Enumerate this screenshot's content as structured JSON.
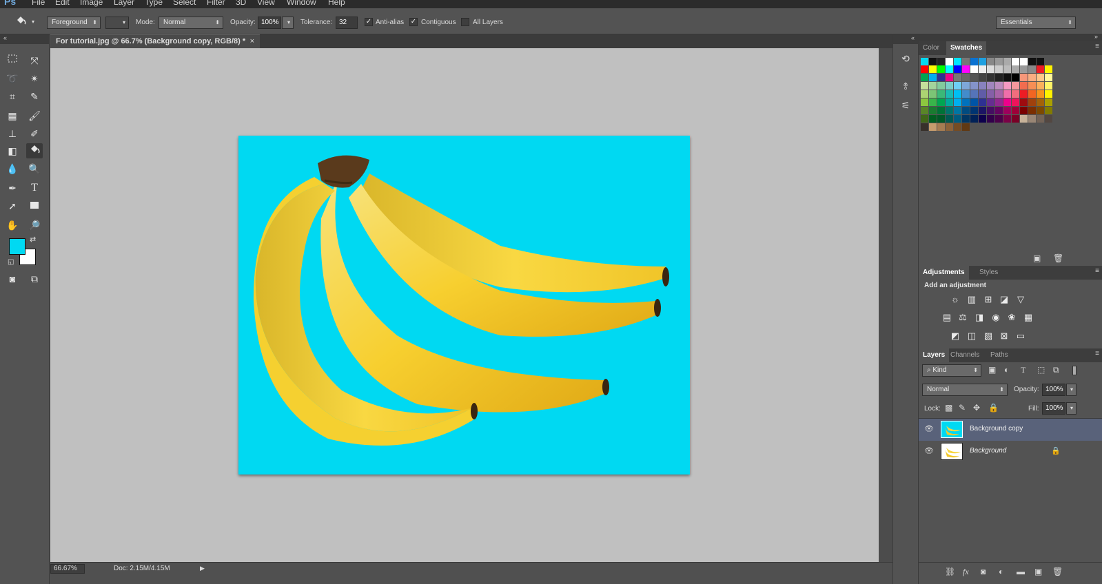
{
  "app": {
    "logo": "Ps"
  },
  "menu": [
    "File",
    "Edit",
    "Image",
    "Layer",
    "Type",
    "Select",
    "Filter",
    "3D",
    "View",
    "Window",
    "Help"
  ],
  "options": {
    "fill_source": "Foreground",
    "mode_label": "Mode:",
    "mode_value": "Normal",
    "opacity_label": "Opacity:",
    "opacity_value": "100%",
    "tolerance_label": "Tolerance:",
    "tolerance_value": "32",
    "anti_alias": "Anti-alias",
    "contiguous": "Contiguous",
    "all_layers": "All Layers",
    "workspace": "Essentials"
  },
  "document": {
    "tab_title": "For tutorial.jpg @ 66.7% (Background copy, RGB/8) *",
    "close": "×",
    "canvas_color": "#00d9f2"
  },
  "status": {
    "zoom": "66.67%",
    "doc_size": "Doc: 2.15M/4.15M"
  },
  "colors": {
    "foreground": "#00d9f2",
    "background": "#ffffff"
  },
  "swatches_panel": {
    "tabs": [
      "Color",
      "Swatches"
    ],
    "active_tab": "Swatches"
  },
  "adjustments_panel": {
    "tabs": [
      "Adjustments",
      "Styles"
    ],
    "heading": "Add an adjustment"
  },
  "layers_panel": {
    "tabs": [
      "Layers",
      "Channels",
      "Paths"
    ],
    "filter_kind": "Kind",
    "blend_mode": "Normal",
    "opacity_label": "Opacity:",
    "opacity_value": "100%",
    "lock_label": "Lock:",
    "fill_label": "Fill:",
    "fill_value": "100%",
    "layers": [
      {
        "name": "Background copy",
        "selected": true
      },
      {
        "name": "Background",
        "selected": false,
        "locked": true
      }
    ]
  }
}
